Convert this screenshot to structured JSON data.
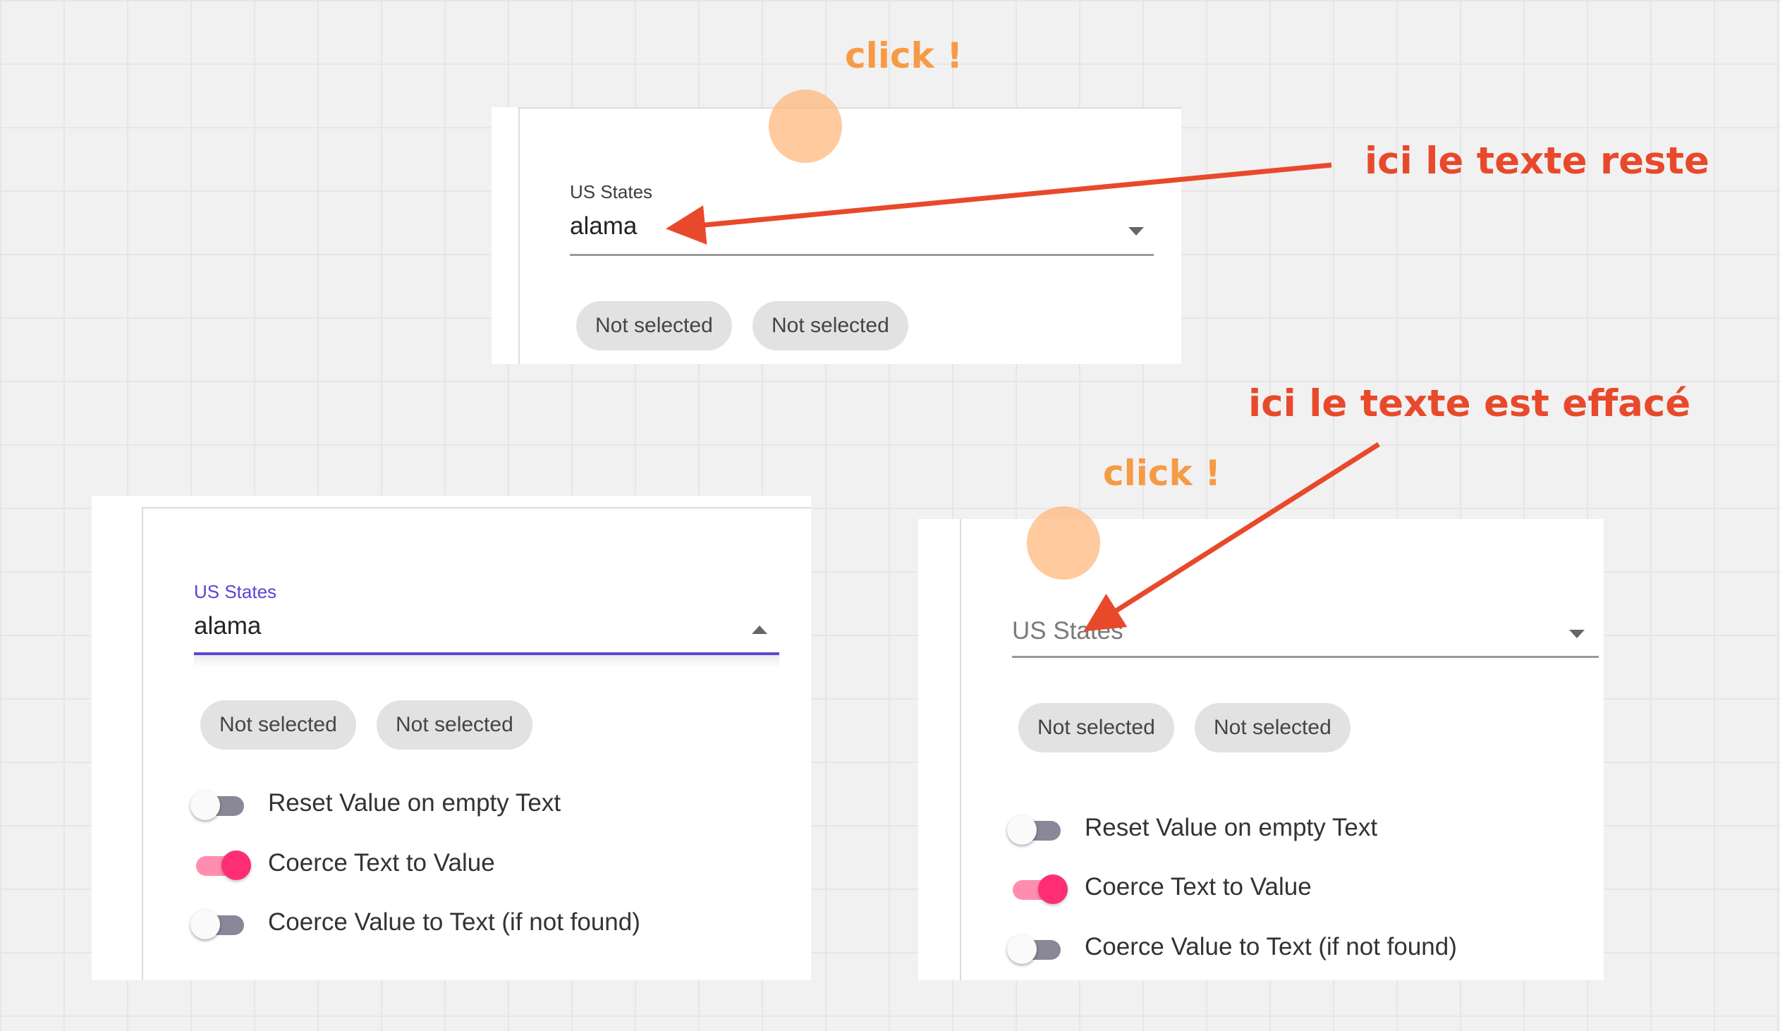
{
  "annotations": {
    "click_top": "click !",
    "click_right": "click !",
    "text_stays": "ici le texte reste",
    "text_erased": "ici le texte est effacé",
    "click_color": "#f79a46",
    "callout_color": "#e8492b"
  },
  "top_panel": {
    "field_label": "US States",
    "field_value": "alama",
    "chips": [
      "Not selected",
      "Not selected"
    ]
  },
  "bottom_left_panel": {
    "field_label": "US States",
    "field_value": "alama",
    "chips": [
      "Not selected",
      "Not selected"
    ],
    "toggles": [
      {
        "label": "Reset Value on empty Text",
        "on": false
      },
      {
        "label": "Coerce Text to Value",
        "on": true
      },
      {
        "label": "Coerce Value to Text (if not found)",
        "on": false
      }
    ]
  },
  "bottom_right_panel": {
    "field_placeholder": "US States",
    "chips": [
      "Not selected",
      "Not selected"
    ],
    "toggles": [
      {
        "label": "Reset Value on empty Text",
        "on": false
      },
      {
        "label": "Coerce Text to Value",
        "on": true
      },
      {
        "label": "Coerce Value to Text (if not found)",
        "on": false
      }
    ]
  },
  "colors": {
    "focus_accent": "#5a44d4",
    "toggle_on": "#ff2e74",
    "toggle_off": "#8a8798"
  },
  "icons": [
    "dropdown-arrow-icon",
    "dropdown-arrow-up-icon",
    "click-indicator-icon",
    "arrow-pointer-icon"
  ]
}
